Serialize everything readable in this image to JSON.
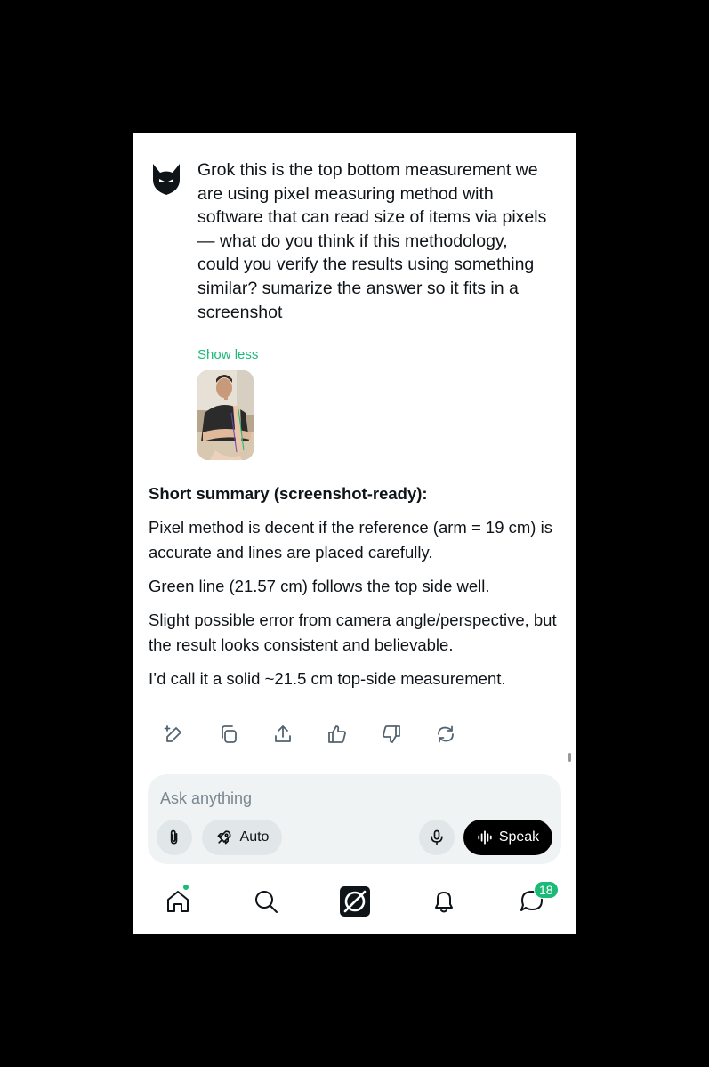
{
  "user_message": {
    "text": "Grok this is the top bottom measurement we are using pixel measuring method with software that can read size of items via pixels — what do you think if this methodology, could you verify the results using something similar? sumarize the answer so it fits in a screenshot",
    "show_less_label": "Show less"
  },
  "answer": {
    "heading": "Short summary (screenshot-ready):",
    "paragraphs": [
      "Pixel method is decent if the reference (arm = 19 cm) is accurate and lines are placed carefully.",
      "Green line (21.57 cm) follows the top side well.",
      "Slight possible error from camera angle/perspective, but the result looks consistent and believable.",
      "I’d call it a solid ~21.5 cm top-side measurement."
    ]
  },
  "actions": [
    "edit-icon",
    "copy-icon",
    "share-icon",
    "thumbs-up-icon",
    "thumbs-down-icon",
    "regenerate-icon"
  ],
  "composer": {
    "placeholder": "Ask anything",
    "value": "",
    "mode_label": "Auto",
    "speak_label": "Speak"
  },
  "nav": {
    "items": [
      "home-icon",
      "search-icon",
      "grok-icon",
      "notifications-icon",
      "messages-icon"
    ],
    "messages_badge": "18"
  },
  "colors": {
    "accent": "#1db977",
    "text": "#0f1419",
    "muted": "#536471",
    "composer_bg": "#eff3f4"
  }
}
